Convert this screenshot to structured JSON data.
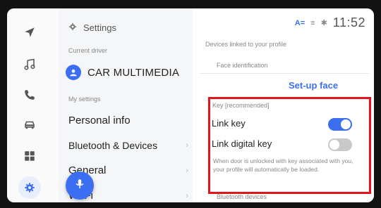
{
  "rail": {
    "icons": [
      "navigation-icon",
      "music-note-icon",
      "phone-icon",
      "car-icon",
      "apps-grid-icon",
      "gear-icon"
    ],
    "active": "gear-icon"
  },
  "panel": {
    "title": "Settings",
    "current_driver_label": "Current driver",
    "driver_name": "CAR MULTIMEDIA",
    "my_settings_label": "My settings",
    "items": [
      {
        "label": "Personal info"
      },
      {
        "label": "Bluetooth & Devices"
      },
      {
        "label": "General"
      },
      {
        "label": "Wi-Fi"
      }
    ]
  },
  "status": {
    "time": "11:52"
  },
  "right": {
    "devices_linked_label": "Devices linked to your profile",
    "face_identification_label": "Face identification",
    "setup_face_label": "Set-up face",
    "key_section_label": "Key [recommended]",
    "link_key_label": "Link key",
    "link_key_on": true,
    "link_digital_key_label": "Link digital key",
    "link_digital_key_on": false,
    "description": "When door is unlocked with key associated with you, your profile will automatically be loaded.",
    "bluetooth_devices_label": "Bluetooth devices"
  },
  "colors": {
    "accent": "#3b6ef0",
    "highlight": "#e0161c"
  }
}
